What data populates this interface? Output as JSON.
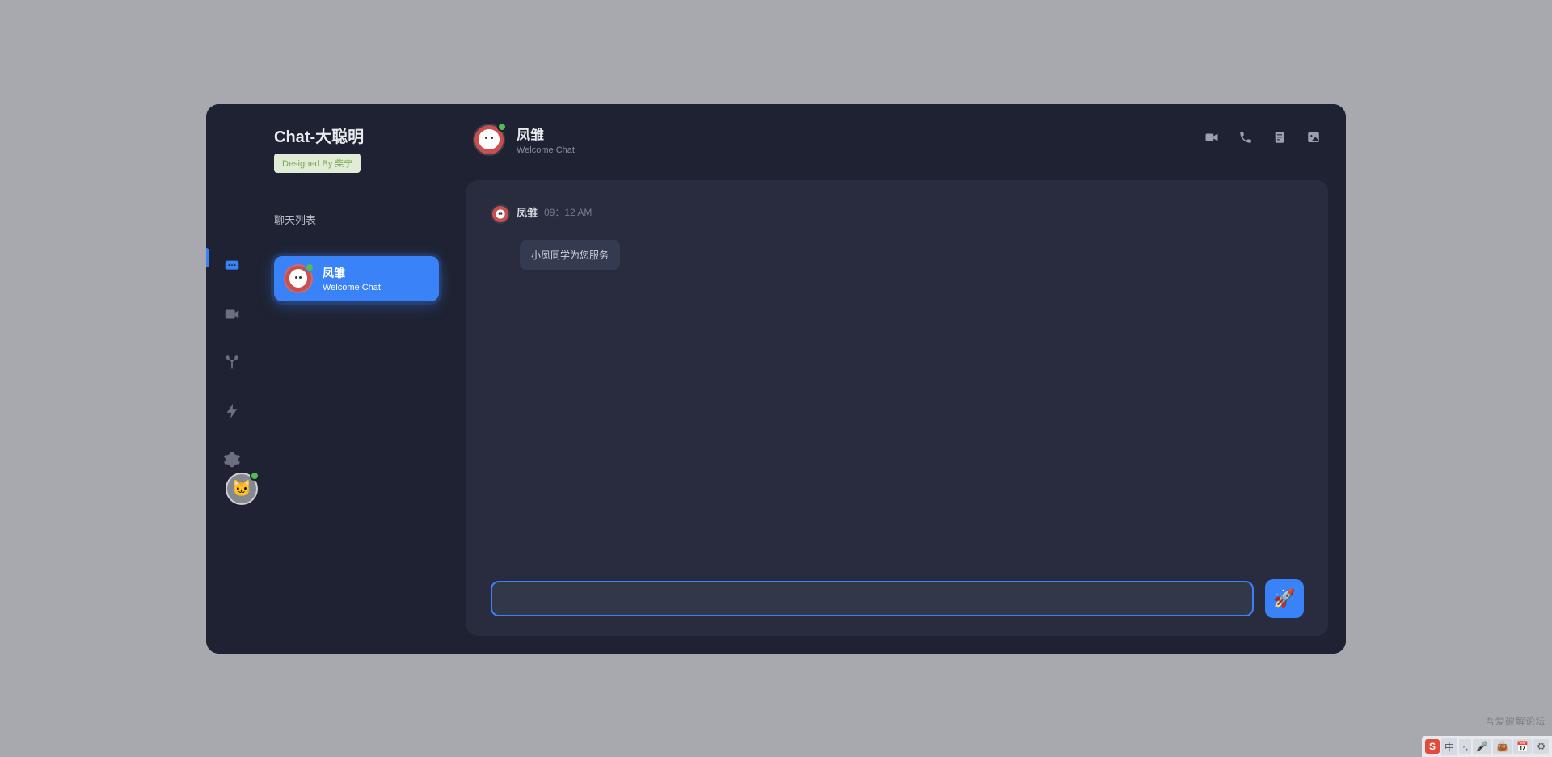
{
  "brand": {
    "title": "Chat-大聪明",
    "badge": "Designed By 柴宁"
  },
  "sidebar": {
    "listLabel": "聊天列表",
    "items": [
      {
        "name": "凤雏",
        "sub": "Welcome Chat"
      }
    ]
  },
  "header": {
    "name": "凤雏",
    "sub": "Welcome Chat"
  },
  "messages": [
    {
      "name": "凤雏",
      "time": "09：12 AM",
      "text": "小凤同学为您服务"
    }
  ],
  "input": {
    "value": ""
  },
  "icons": {
    "send": "🚀",
    "catAvatar": "🐱"
  },
  "watermark": "吾爱破解论坛",
  "ime": {
    "s": "S",
    "zh": "中",
    "segs": [
      "·,",
      "🎤",
      "👜",
      "📅",
      "⚙"
    ]
  }
}
